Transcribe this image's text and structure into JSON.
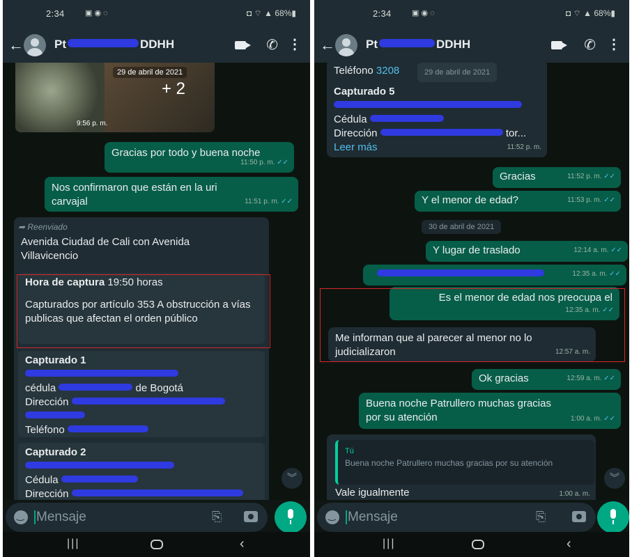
{
  "left": {
    "status": {
      "time": "2:34",
      "battery": "68%"
    },
    "header": {
      "name_prefix": "Pt",
      "name_suffix": "DDHH"
    },
    "photo": {
      "date": "29 de abril de 2021",
      "more": "+ 2",
      "time": "9:56 p. m."
    },
    "messages": [
      {
        "text": "Gracias por todo y buena noche",
        "time": "11:50 p. m."
      },
      {
        "text": "Nos confirmaron que están en la uri carvajal",
        "time": "11:51 p. m."
      }
    ],
    "forwarded": {
      "label": "Reenviado",
      "location": "Avenida Ciudad de Cali con Avenida Villavicencio",
      "capture_label": "Hora de captura",
      "capture_time": "19:50 horas",
      "charges": "Capturados por artículo 353 A obstrucción a vías publicas que afectan el orden público",
      "c1_title": "Capturado 1",
      "c1_cedula": "cédula",
      "c1_city": "de Bogotá",
      "c1_dir": "Dirección",
      "c1_tel": "Teléfono",
      "c2_title": "Capturado 2",
      "c2_cedula": "Cédula",
      "c2_dir": "Dirección"
    },
    "input": {
      "placeholder": "Mensaje"
    }
  },
  "right": {
    "status": {
      "time": "2:34",
      "battery": "68%"
    },
    "header": {
      "name_prefix": "Pt",
      "name_suffix": "DDHH"
    },
    "top_bubble": {
      "tel": "Teléfono",
      "tel_digits": "3208",
      "date_overlay": "29 de abril de 2021",
      "c5_title": "Capturado 5",
      "c5_cedula": "Cédula",
      "c5_dir": "Dirección",
      "c5_dir_end": "tor...",
      "read_more": "Leer más",
      "time": "11:52 p. m."
    },
    "messages": [
      {
        "text": "Gracias",
        "time": "11:52 p. m."
      },
      {
        "text": "Y el menor de edad?",
        "time": "11:53 p. m."
      },
      {
        "text": "Y lugar de traslado",
        "time": "12:14 a. m."
      },
      {
        "text": "",
        "time": "12:35 a. m."
      },
      {
        "text": "Es el menor de edad nos preocupa el",
        "time": "12:35 a. m."
      },
      {
        "text": "Me informan que al parecer al menor no lo judicializaron",
        "time": "12:57 a. m."
      },
      {
        "text": "Ok gracias",
        "time": "12:59 a. m."
      },
      {
        "text": "Buena noche Patrullero muchas gracias por su atención",
        "time": "1:00 a. m."
      }
    ],
    "date_chip": "30 de abril de 2021",
    "reply": {
      "quoted_author": "Tú",
      "quoted_text": "Buena noche Patrullero muchas gracias por su atención",
      "text": "Vale igualmente",
      "time": "1:00 a. m."
    },
    "input": {
      "placeholder": "Mensaje"
    }
  },
  "colors": {
    "incoming": "#1f2c33",
    "outgoing": "#075e48",
    "accent": "#00a884",
    "redaction": "#2f3ae0",
    "highlight_box": "#d9262a"
  },
  "icons": [
    "back-arrow-icon",
    "avatar",
    "video-call-icon",
    "phone-icon",
    "more-icon",
    "emoji-icon",
    "attach-icon",
    "camera-icon",
    "mic-icon",
    "scroll-down-icon",
    "forward-icon",
    "nav-recents-icon",
    "nav-home-icon",
    "nav-back-icon"
  ]
}
